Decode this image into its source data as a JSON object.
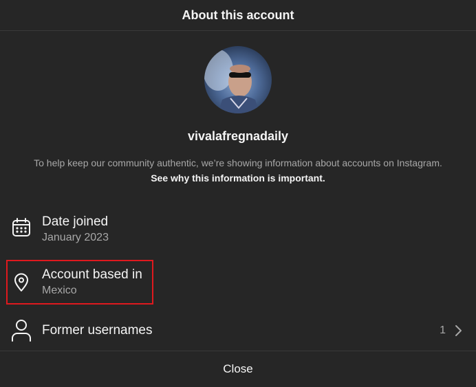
{
  "dialog": {
    "title": "About this account",
    "close_label": "Close"
  },
  "profile": {
    "username": "vivalafregnadaily",
    "avatar_icon": "profile-photo",
    "description_text": "To help keep our community authentic, we’re showing information about accounts on Instagram. ",
    "description_link": "See why this information is important."
  },
  "details": {
    "date_joined": {
      "icon": "calendar-icon",
      "label": "Date joined",
      "value": "January 2023"
    },
    "account_based_in": {
      "icon": "location-pin-icon",
      "label": "Account based in",
      "value": "Mexico",
      "highlight_color": "#e0191e"
    },
    "former_usernames": {
      "icon": "person-icon",
      "label": "Former usernames",
      "count": "1"
    }
  },
  "colors": {
    "background": "#262626",
    "text_primary": "#f5f5f5",
    "text_secondary": "#a8a8a8",
    "divider": "#3a3a3a"
  }
}
